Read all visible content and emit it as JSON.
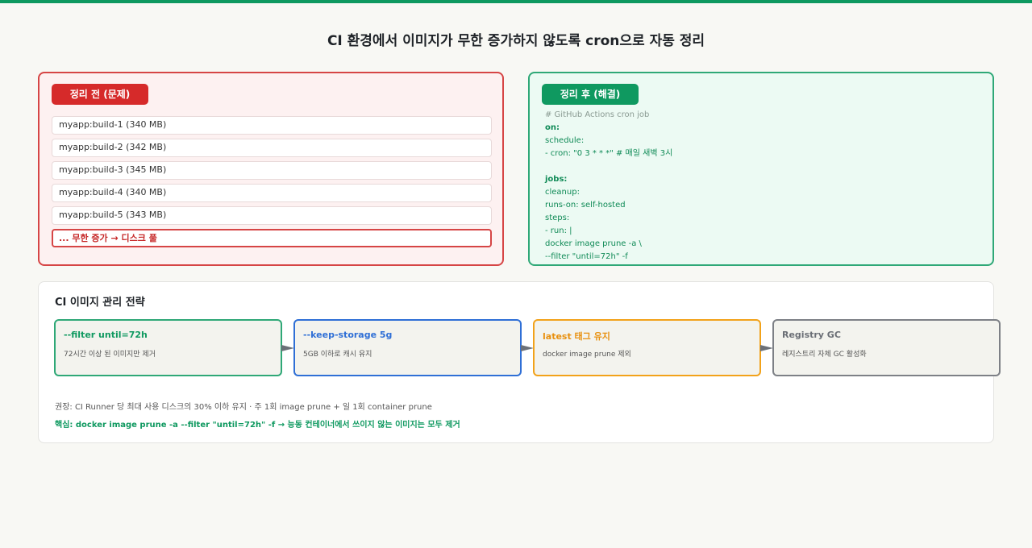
{
  "title": "CI 환경에서 이미지가 무한 증가하지 않도록 cron으로 자동 정리",
  "before": {
    "label": "정리 전 (문제)",
    "builds": [
      "myapp:build-1 (340 MB)",
      "myapp:build-2 (342 MB)",
      "myapp:build-3 (345 MB)",
      "myapp:build-4 (340 MB)",
      "myapp:build-5 (343 MB)"
    ],
    "warning": "... 무한 증가 → 디스크 풀"
  },
  "after": {
    "label": "정리 후 (해결)",
    "code": [
      "# GitHub Actions cron job",
      "on:",
      "schedule:",
      "- cron: \"0 3 * * *\" # 매일 새벽 3시",
      "",
      "jobs:",
      "cleanup:",
      "runs-on: self-hosted",
      "steps:",
      "- run: |",
      "docker image prune -a \\",
      "--filter \"until=72h\" -f"
    ]
  },
  "strategy": {
    "title": "CI 이미지 관리 전략",
    "cards": [
      {
        "title": "--filter until=72h",
        "desc": "72시간 이상 된 이미지만 제거"
      },
      {
        "title": "--keep-storage 5g",
        "desc": "5GB 이하로 캐시 유지"
      },
      {
        "title": "latest 태그 유지",
        "desc": "docker image prune 제외"
      },
      {
        "title": "Registry GC",
        "desc": "레지스트리 자체 GC 활성화"
      }
    ],
    "note": "권장: CI Runner 당 최대 사용 디스크의 30% 이하 유지 · 주 1회 image prune + 일 1회 container prune",
    "key_note": "핵심: docker image prune -a --filter \"until=72h\" -f → 능동 컨테이너에서 쓰이지 않는 이미지는 모두 제거"
  },
  "colors": {
    "accent_green": "#0f9960",
    "problem_red": "#d62a2a",
    "blue": "#2f6fd6",
    "orange": "#f2a21a",
    "gray": "#7d8086"
  }
}
